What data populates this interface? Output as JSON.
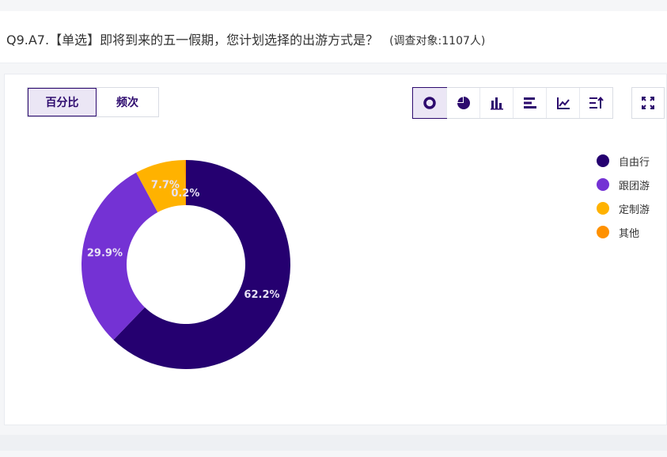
{
  "question": {
    "title": "Q9.A7.【单选】即将到来的五一假期，您计划选择的出游方式是？",
    "note": "(调查对象:1107人)"
  },
  "toggle": {
    "percent_label": "百分比",
    "count_label": "频次",
    "active": "percent"
  },
  "chart_types": [
    "donut",
    "pie",
    "bar",
    "horizontal-bar",
    "line",
    "sort"
  ],
  "active_chart_type": "donut",
  "chart_data": {
    "type": "pie",
    "categories": [
      "自由行",
      "跟团游",
      "定制游",
      "其他"
    ],
    "values": [
      62.2,
      29.9,
      7.7,
      0.2
    ],
    "labels": [
      "62.2%",
      "29.9%",
      "7.7%",
      "0.2%"
    ],
    "colors": [
      "#250070",
      "#7432d4",
      "#ffb200",
      "#ff9100"
    ],
    "legend_position": "right"
  }
}
